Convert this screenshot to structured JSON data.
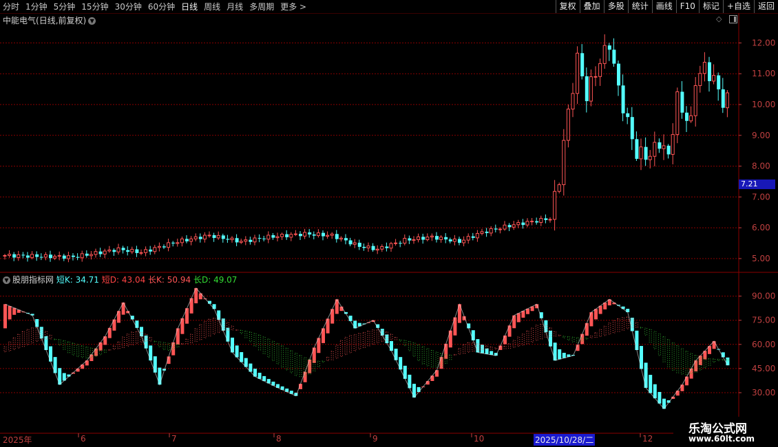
{
  "toolbar": {
    "periods": [
      "分时",
      "1分钟",
      "5分钟",
      "15分钟",
      "30分钟",
      "60分钟",
      "日线",
      "周线",
      "月线",
      "多周期",
      "更多 >"
    ],
    "buttons": [
      "复权",
      "叠加",
      "多股",
      "统计",
      "画线",
      "F10",
      "标记",
      "+自选",
      "返回"
    ]
  },
  "stock": {
    "name": "中能电气",
    "title_suffix": "(日线,前复权)",
    "current_price_label": "7.21"
  },
  "indicator": {
    "name": "股朋指标网",
    "short_k": "短K: 34.71",
    "short_d": "短D: 43.04",
    "long_k": "长K: 50.94",
    "long_d": "长D: 49.07"
  },
  "axis": {
    "price_ticks": [
      "12.00",
      "11.00",
      "10.00",
      "9.00",
      "8.00",
      "7.00",
      "6.00",
      "5.00"
    ],
    "indicator_ticks": [
      "90.00",
      "75.00",
      "60.00",
      "45.00",
      "30.00"
    ],
    "dates": [
      "2025年",
      "6",
      "7",
      "8",
      "9",
      "10",
      "2025/10/28/二",
      "12"
    ]
  },
  "watermark": {
    "title": "乐淘公式网",
    "url": "www.60lt.com"
  },
  "colors": {
    "up": "#ff5555",
    "down": "#54ffff",
    "grid": "#8b0000",
    "short_d": "#ff4444",
    "long_k": "#ff5555",
    "long_d": "#33bb33",
    "highlight": "#1818b8"
  }
}
